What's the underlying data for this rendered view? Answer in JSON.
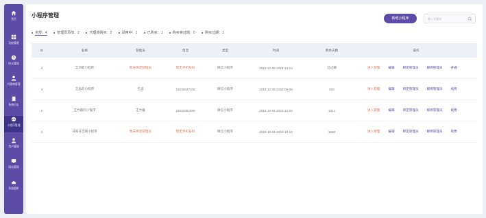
{
  "sidebar": {
    "items": [
      {
        "label": "首页",
        "icon": "home-icon"
      },
      {
        "label": "功能管理",
        "icon": "grid-icon"
      },
      {
        "label": "时长管理",
        "icon": "clock-icon"
      },
      {
        "label": "代理商管理",
        "icon": "user-icon"
      },
      {
        "label": "系统日志",
        "icon": "book-icon"
      },
      {
        "label": "小程序管理",
        "icon": "miniprogram-icon",
        "active": true
      },
      {
        "label": "用户管理",
        "icon": "users-icon"
      },
      {
        "label": "网站管理",
        "icon": "monitor-icon"
      },
      {
        "label": "系统更新",
        "icon": "cloud-icon"
      }
    ]
  },
  "header": {
    "title": "小程序管理",
    "add_button": "新增小程序",
    "search_placeholder": "输入关键词"
  },
  "filters": [
    {
      "label": "全部：4",
      "active": true
    },
    {
      "label": "管理员添加：2"
    },
    {
      "label": "代理商购买：2"
    },
    {
      "label": "试用中：1"
    },
    {
      "label": "已购买：1"
    },
    {
      "label": "购买将过期：0"
    },
    {
      "label": "购买过期：1"
    }
  ],
  "table": {
    "columns": [
      "ID",
      "名称",
      "管理员",
      "电话",
      "类型",
      "时间",
      "剩余天数",
      "操作"
    ],
    "rows": [
      {
        "id": "4",
        "name": "全功能小程序",
        "admin": "暂未绑定管理员",
        "phone": "暂无手机号码",
        "type": "微信小程序",
        "time": "2018-12-06-2018-12-13",
        "days": "已过期",
        "ops": [
          "进入管理",
          "编辑",
          "绑定管理员",
          "解绑管理员",
          "开通"
        ]
      },
      {
        "id": "3",
        "name": "王晶的小程序",
        "admin": "王晶",
        "phone": "15230627108",
        "type": "微信小程序",
        "time": "2018-12-05-2022-09-05",
        "days": "829",
        "ops": [
          "进入管理",
          "编辑",
          "绑定管理员",
          "解绑管理员",
          "续费"
        ]
      },
      {
        "id": "2",
        "name": "王竹璇的小程序",
        "admin": "王竹璇",
        "phone": "18632092090",
        "type": "微信小程序",
        "time": "2018-12-04-2022-12-04",
        "days": "1011",
        "ops": [
          "进入管理",
          "编辑",
          "绑定管理员",
          "解绑管理员",
          "续费"
        ]
      },
      {
        "id": "1",
        "name": "日照仟吉网小程序",
        "admin": "暂未绑定管理员",
        "phone": "暂无手机号码",
        "type": "微信小程序",
        "time": "2018-10-04-2024-10-16",
        "days": "1693",
        "ops": [
          "进入管理",
          "编辑",
          "绑定管理员",
          "解绑管理员",
          "续费"
        ]
      }
    ]
  },
  "colors": {
    "accent": "#5d4ca6",
    "danger": "#e2735a",
    "header_bg": "#edf0f7"
  }
}
